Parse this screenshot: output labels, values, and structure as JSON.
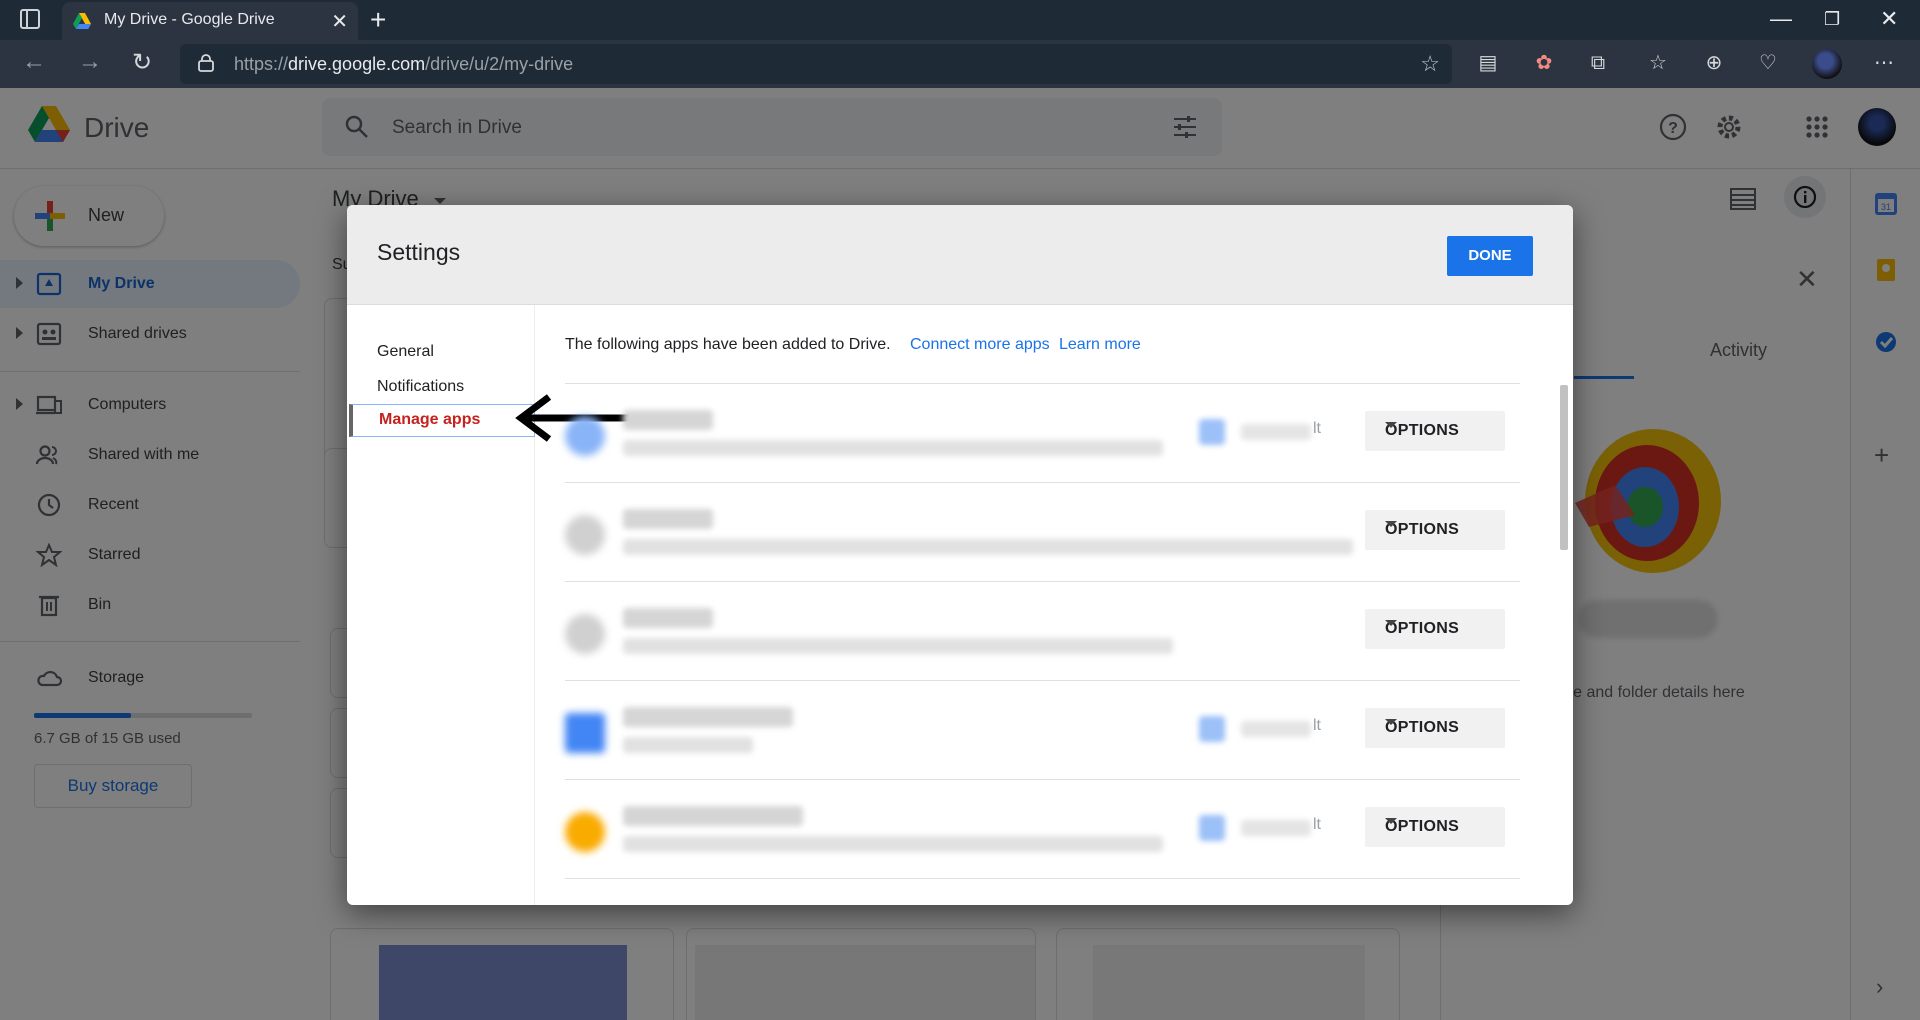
{
  "browser": {
    "tab_title": "My Drive - Google Drive",
    "url_prefix": "https://",
    "url_host": "drive.google.com",
    "url_path": "/drive/u/2/my-drive"
  },
  "drive": {
    "app_name": "Drive",
    "search_placeholder": "Search in Drive",
    "new_label": "New",
    "main_title": "My Drive",
    "main_sub": "Su",
    "nav": [
      {
        "label": "My Drive"
      },
      {
        "label": "Shared drives"
      },
      {
        "label": "Computers"
      },
      {
        "label": "Shared with me"
      },
      {
        "label": "Recent"
      },
      {
        "label": "Starred"
      },
      {
        "label": "Bin"
      },
      {
        "label": "Storage"
      }
    ],
    "storage_used": "6.7 GB of 15 GB used",
    "storage_fraction": 0.447,
    "buy_storage": "Buy storage",
    "details_tab_activity": "Activity",
    "details_hint": "ile and folder details here"
  },
  "settings": {
    "title": "Settings",
    "done_label": "DONE",
    "nav": {
      "general": "General",
      "notifications": "Notifications",
      "manage_apps": "Manage apps"
    },
    "intro_text": "The following apps have been added to Drive.",
    "connect_link": "Connect more apps",
    "learn_link": "Learn more",
    "options_label": "OPTIONS",
    "default_suffix": "lt",
    "accent": "#1a73e8",
    "active_color": "#c5221f"
  }
}
